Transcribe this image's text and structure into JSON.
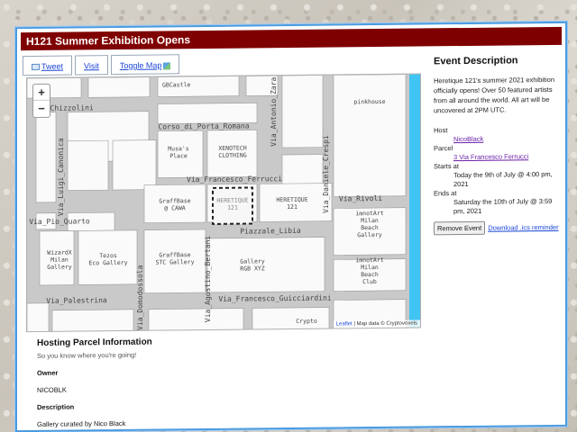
{
  "header": {
    "title": "H121 Summer Exhibition Opens"
  },
  "buttons": {
    "tweet": "Tweet",
    "visit": "Visit",
    "toggle_map": "Toggle Map"
  },
  "map": {
    "zoom_in": "+",
    "zoom_out": "−",
    "attribution_link": "Leaflet",
    "attribution_text": " | Map data © Cryptovoxels",
    "streets": {
      "chizzolini": "Via_Chizzolini",
      "porta_romana": "Corso_di_Porta_Romana",
      "ferrucci": "Via_Francesco_Ferrucci",
      "rivoli": "Via_Rivoli",
      "pio_quarto": "Via_Pio_Quarto",
      "libia": "Piazzale_Libia",
      "palestrina": "Via_Palestrina",
      "guicciardini": "Via_Francesco_Guicciardini",
      "canonica": "Via_Luigi_Canonica",
      "zara": "Via_Antonio_Zara",
      "crespi": "Via_Daniele_Crespi",
      "bertani": "Via_Agostino_Bertani",
      "domodossola": "Via_Domodossola"
    },
    "parcels": {
      "gbcastle": "GBCastle",
      "pinkhouse": "pinkhouse",
      "musas": "Musa's\nPlace",
      "xenotech": "XENOTECH\nCLOTHING",
      "graffbase_cawa": "GraffBase\n@ CAWA",
      "heretique_sel": "HERETIQUE\n121",
      "heretique": "HERETIQUE\n121",
      "imnotart1": "imnotArt\nMilan\nBeach\nGallery",
      "wizardx": "WizardX\nMilan\nGallery",
      "tezos": "Tezos\nEco Gallery",
      "graffbase_stc": "GraffBase\nSTC Gallery",
      "rgbxyz": "Gallery\nRGB XYZ",
      "imnotart2": "imnotArt\nMilan\nBeach\nClub",
      "crypto": "Crypto"
    }
  },
  "event": {
    "heading": "Event Description",
    "description": "Heretique 121's summer 2021 exhibition officially opens! Over 50 featured artists from all around the world. All art will be uncovered at 2PM UTC.",
    "host_label": "Host",
    "host_value": "NicoBlack",
    "parcel_label": "Parcel",
    "parcel_value": "3 Via Francesco Ferrucci",
    "starts_label": "Starts at",
    "starts_value": "Today the 9th of July @ 4:00 pm, 2021",
    "ends_label": "Ends at",
    "ends_value": "Saturday the 10th of July @ 3:59 pm, 2021",
    "remove_button": "Remove Event",
    "ics_link": "Download .ics reminder"
  },
  "hosting": {
    "heading": "Hosting Parcel Information",
    "subheading": "So you know where you're going!",
    "owner_label": "Owner",
    "owner_value": "NICOBLK",
    "description_label": "Description",
    "description_value": "Gallery curated by Nico Black"
  },
  "colors": {
    "title_bar": "#7f0000",
    "link": "#1a45d6",
    "visited_link": "#6b1fa8",
    "water": "#40c4f4",
    "panel_border": "#4a9be0"
  }
}
